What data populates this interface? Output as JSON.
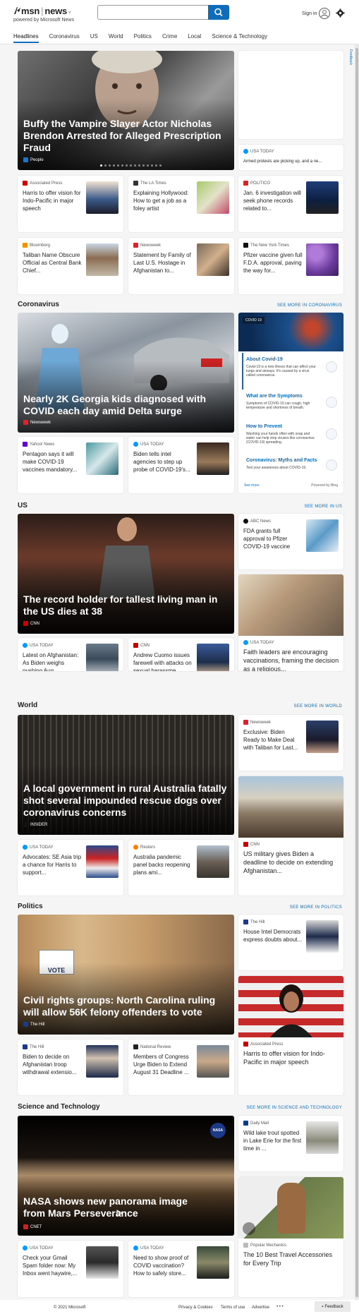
{
  "header": {
    "logo_msn": "msn",
    "logo_news": "news",
    "powered_by": "powered by Microsoft News",
    "search_placeholder": "",
    "signin": "Sign in"
  },
  "nav": [
    "Headlines",
    "Coronavirus",
    "US",
    "World",
    "Politics",
    "Crime",
    "Local",
    "Science & Technology"
  ],
  "feedback_vert": "Feedback",
  "headlines": {
    "hero": {
      "title": "Buffy the Vampire Slayer Actor Nicholas Brendon Arrested for Alleged Prescription Fraud",
      "source": "People"
    },
    "side_small": {
      "source": "USA TODAY",
      "title": "Armed protests are picking up, and a ne..."
    },
    "cards": [
      {
        "source": "Associated Press",
        "title": "Harris to offer vision for Indo-Pacific in major speech"
      },
      {
        "source": "The LA Times",
        "title": "Explaining Hollywood: How to get a job as a foley artist"
      },
      {
        "source": "POLITICO",
        "title": "Jan. 6 investigation will seek phone records related to..."
      },
      {
        "source": "Bloomberg",
        "title": "Taliban Name Obscure Official as Central Bank Chief..."
      },
      {
        "source": "Newsweek",
        "title": "Statement by Family of Last U.S. Hostage in Afghanistan to..."
      },
      {
        "source": "The New York Times",
        "title": "Pfizer vaccine given full F.D.A. approval, paving the way for..."
      }
    ]
  },
  "coronavirus": {
    "title": "Coronavirus",
    "more": "SEE MORE IN CORONAVIRUS",
    "hero": {
      "title": "Nearly 2K Georgia kids diagnosed with COVID each day amid Delta surge",
      "source": "Newsweek"
    },
    "cards": [
      {
        "source": "Yahoo! News",
        "title": "Pentagon says it will make COVID-19 vaccines mandatory..."
      },
      {
        "source": "USA TODAY",
        "title": "Biden tells intel agencies to step up probe of COVID-19's..."
      }
    ],
    "panel": {
      "badge": "COVID 19",
      "items": [
        {
          "title": "About Covid-19",
          "desc": "Covid-19 is a new illness that can affect your lungs and airways. It's caused by a virus called coronavirus."
        },
        {
          "title": "What are the Symptoms",
          "desc": "Symptoms of COVID-19 can cough, high temperature and shortness of breath."
        },
        {
          "title": "How to Prevent",
          "desc": "Washing your hands often with soap and water can help stop viruses like coronavirus (COVID-19) spreading."
        },
        {
          "title": "Coronavirus: Myths and Facts",
          "desc": "Test your awareness about COVID-19."
        }
      ],
      "see_more": "See more",
      "powered": "Powered by Bing"
    }
  },
  "us": {
    "title": "US",
    "more": "SEE MORE IN US",
    "hero": {
      "title": "The record holder for tallest living man in the US dies at 38",
      "source": "CNN"
    },
    "side_small": {
      "source": "ABC News",
      "title": "FDA grants full approval to Pfizer COVID-19 vaccine"
    },
    "side_big": {
      "source": "USA TODAY",
      "title": "Faith leaders are encouraging vaccinations, framing the decision as a religious..."
    },
    "cards": [
      {
        "source": "USA TODAY",
        "title": "Latest on Afghanistan: As Biden weighs pushing Aug..."
      },
      {
        "source": "CNN",
        "title": "Andrew Cuomo issues farewell with attacks on sexual harassme..."
      }
    ]
  },
  "world": {
    "title": "World",
    "more": "SEE MORE IN WORLD",
    "hero": {
      "title": "A local government in rural Australia fatally shot several impounded rescue dogs over coronavirus concerns",
      "source": "INSIDER"
    },
    "side_small": {
      "source": "Newsweek",
      "title": "Exclusive: Biden Ready to Make Deal with Taliban for Last..."
    },
    "side_big": {
      "source": "CNN",
      "title": "US military gives Biden a deadline to decide on extending Afghanistan..."
    },
    "cards": [
      {
        "source": "USA TODAY",
        "title": "Advocates: SE Asia trip a chance for Harris to support..."
      },
      {
        "source": "Reuters",
        "title": "Australia pandemic panel backs reopening plans ami..."
      }
    ]
  },
  "politics": {
    "title": "Politics",
    "more": "SEE MORE IN POLITICS",
    "hero": {
      "title": "Civil rights groups: North Carolina ruling will allow 56K felony offenders to vote",
      "source": "The Hill",
      "sign": "VOTE"
    },
    "side_small": {
      "source": "The Hill",
      "title": "House Intel Democrats express doubts about..."
    },
    "side_big": {
      "source": "Associated Press",
      "title": "Harris to offer vision for Indo-Pacific in major speech"
    },
    "cards": [
      {
        "source": "The Hill",
        "title": "Biden to decide on Afghanistan troop withdrawal extensio..."
      },
      {
        "source": "National Review",
        "title": "Members of Congress Urge Biden to Extend August 31 Deadline ..."
      }
    ]
  },
  "scitech": {
    "title": "Science and Technology",
    "more": "SEE MORE IN SCIENCE AND TECHNOLOGY",
    "hero": {
      "title": "NASA shows new panorama image from Mars Perseverance",
      "source": "CNET",
      "badge": "NASA"
    },
    "side_small": {
      "source": "Daily Mail",
      "title": "Wild lake trout spotted in Lake Erie for the first time in ..."
    },
    "side_big": {
      "source": "Popular Mechanics",
      "title": "The 10 Best Travel Accessories for Every Trip"
    },
    "cards": [
      {
        "source": "USA TODAY",
        "title": "Check your Gmail Spam folder now: My Inbox went haywire,..."
      },
      {
        "source": "USA TODAY",
        "title": "Need to show proof of COVID vaccination? How to safely store..."
      }
    ]
  },
  "footer": {
    "copyright": "© 2021 Microsoft",
    "privacy": "Privacy & Cookies",
    "terms": "Terms of use",
    "advertise": "Advertise",
    "dots": "• • •",
    "feedback": "Feedback"
  },
  "colors": {
    "accent": "#0f6cbd",
    "usatoday": "#009bff",
    "cnn": "#cc0000",
    "newsweek": "#e41e2b"
  }
}
